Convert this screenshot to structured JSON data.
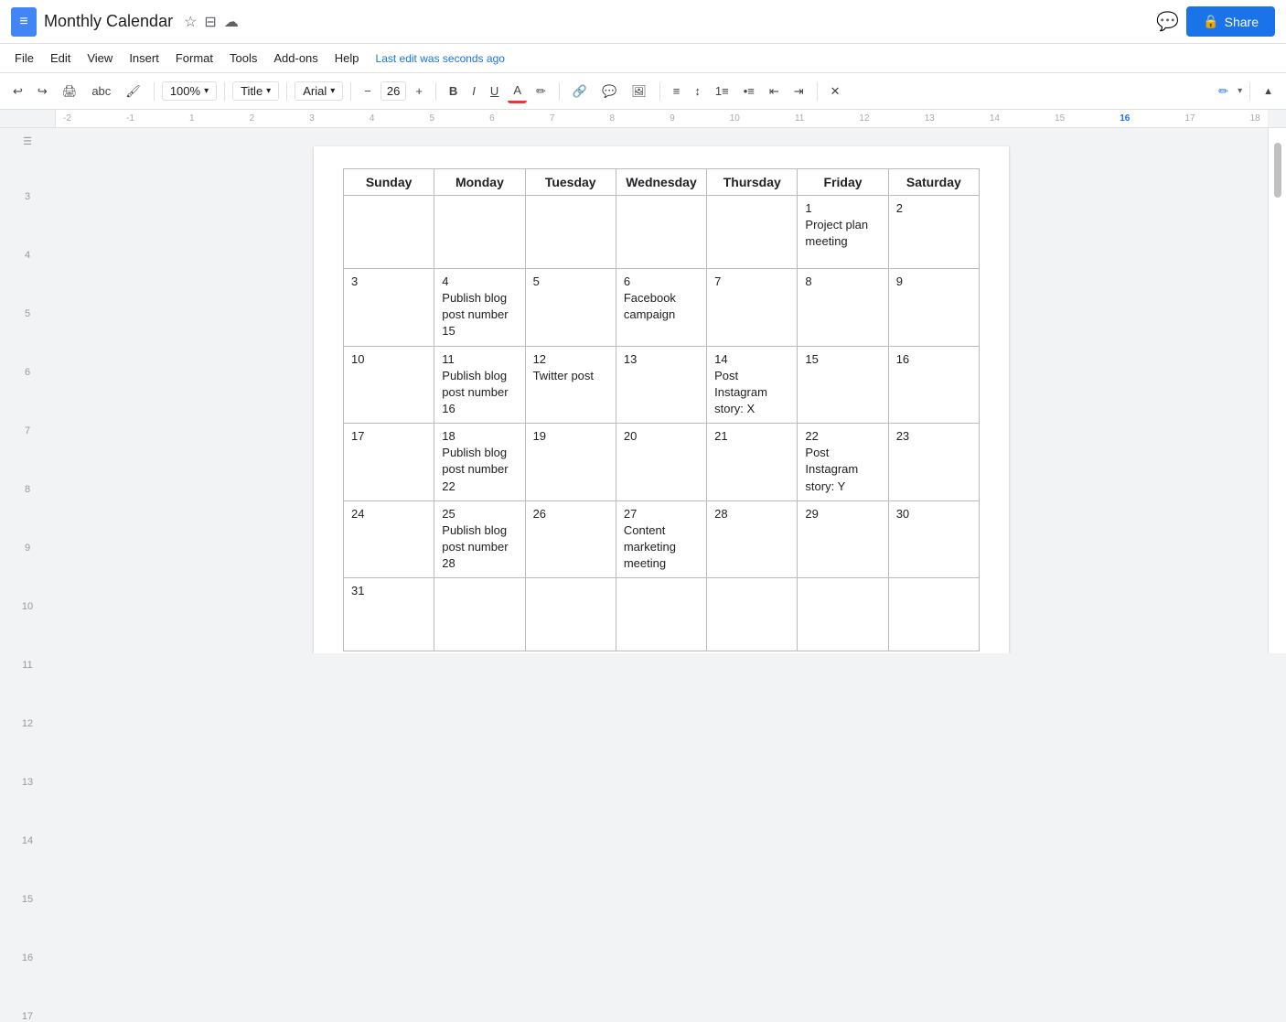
{
  "app": {
    "title": "Monthly Calendar",
    "doc_icon": "≡",
    "star_icon": "☆",
    "folder_icon": "⊟",
    "cloud_icon": "☁"
  },
  "header": {
    "last_edit": "Last edit was seconds ago",
    "share_label": "Share",
    "chat_icon": "💬"
  },
  "menu": {
    "items": [
      "File",
      "Edit",
      "View",
      "Insert",
      "Format",
      "Tools",
      "Add-ons",
      "Help"
    ]
  },
  "toolbar": {
    "undo": "↩",
    "redo": "↪",
    "print": "🖨",
    "paint_format": "A",
    "zoom": "100%",
    "style": "Title",
    "font": "Arial",
    "font_minus": "−",
    "font_size": "26",
    "font_plus": "+",
    "bold": "B",
    "italic": "I",
    "underline": "U",
    "text_color": "A",
    "highlight": "✎",
    "link": "🔗",
    "comment": "💬",
    "image": "🖼",
    "align": "≡",
    "line_spacing": "↕",
    "numbered_list": "1≡",
    "bulleted_list": "•≡",
    "indent_less": "⇤",
    "indent_more": "⇥",
    "clear_format": "✕"
  },
  "calendar": {
    "headers": [
      "Sunday",
      "Monday",
      "Tuesday",
      "Wednesday",
      "Thursday",
      "Friday",
      "Saturday"
    ],
    "rows": [
      [
        {
          "day": "",
          "event": ""
        },
        {
          "day": "",
          "event": ""
        },
        {
          "day": "",
          "event": ""
        },
        {
          "day": "",
          "event": ""
        },
        {
          "day": "",
          "event": ""
        },
        {
          "day": "1",
          "event": "Project plan meeting"
        },
        {
          "day": "2",
          "event": ""
        }
      ],
      [
        {
          "day": "3",
          "event": ""
        },
        {
          "day": "4",
          "event": "Publish blog post number 15"
        },
        {
          "day": "5",
          "event": ""
        },
        {
          "day": "6",
          "event": "Facebook campaign"
        },
        {
          "day": "7",
          "event": ""
        },
        {
          "day": "8",
          "event": ""
        },
        {
          "day": "9",
          "event": ""
        }
      ],
      [
        {
          "day": "10",
          "event": ""
        },
        {
          "day": "11",
          "event": "Publish blog post number 16"
        },
        {
          "day": "12",
          "event": "Twitter post"
        },
        {
          "day": "13",
          "event": ""
        },
        {
          "day": "14",
          "event": "Post Instagram story: X"
        },
        {
          "day": "15",
          "event": ""
        },
        {
          "day": "16",
          "event": ""
        }
      ],
      [
        {
          "day": "17",
          "event": ""
        },
        {
          "day": "18",
          "event": "Publish blog post number 22"
        },
        {
          "day": "19",
          "event": ""
        },
        {
          "day": "20",
          "event": ""
        },
        {
          "day": "21",
          "event": ""
        },
        {
          "day": "22",
          "event": "Post Instagram story: Y"
        },
        {
          "day": "23",
          "event": ""
        }
      ],
      [
        {
          "day": "24",
          "event": ""
        },
        {
          "day": "25",
          "event": "Publish blog post number 28"
        },
        {
          "day": "26",
          "event": ""
        },
        {
          "day": "27",
          "event": "Content marketing meeting"
        },
        {
          "day": "28",
          "event": ""
        },
        {
          "day": "29",
          "event": ""
        },
        {
          "day": "30",
          "event": ""
        }
      ],
      [
        {
          "day": "31",
          "event": ""
        },
        {
          "day": "",
          "event": ""
        },
        {
          "day": "",
          "event": ""
        },
        {
          "day": "",
          "event": ""
        },
        {
          "day": "",
          "event": ""
        },
        {
          "day": "",
          "event": ""
        },
        {
          "day": "",
          "event": ""
        }
      ]
    ]
  }
}
